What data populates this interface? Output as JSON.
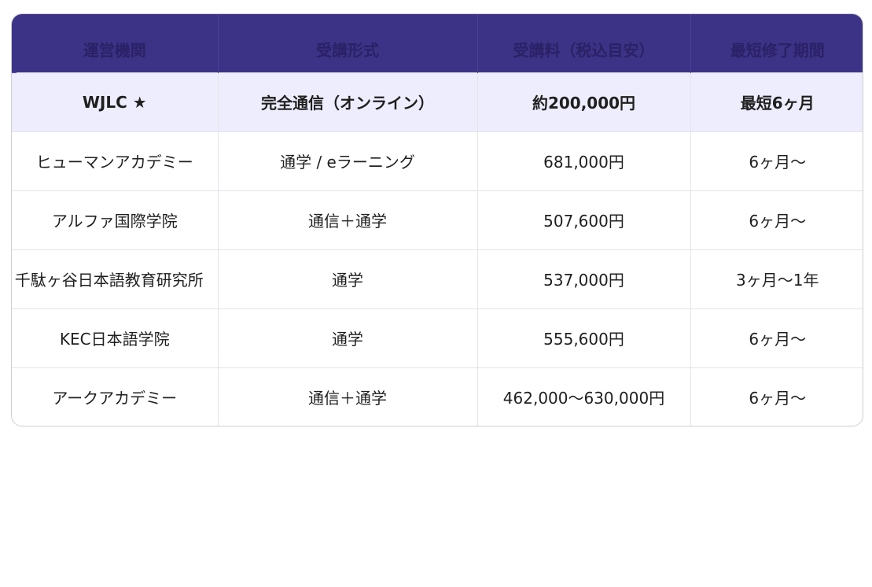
{
  "headers": [
    "運営機関",
    "受講形式",
    "受講料（税込目安）",
    "最短修了期間"
  ],
  "rows": [
    {
      "name": "WJLC ★",
      "format": "完全通信（オンライン）",
      "fee": "約200,000円",
      "period": "最短6ヶ月",
      "highlight": true
    },
    {
      "name": "ヒューマンアカデミー",
      "format": "通学 / eラーニング",
      "fee": "681,000円",
      "period": "6ヶ月〜"
    },
    {
      "name": "アルファ国際学院",
      "format": "通信＋通学",
      "fee": "507,600円",
      "period": "6ヶ月〜"
    },
    {
      "name": "千駄ヶ谷日本語教育研究所",
      "format": "通学",
      "fee": "537,000円",
      "period": "3ヶ月〜1年"
    },
    {
      "name": "KEC日本語学院",
      "format": "通学",
      "fee": "555,600円",
      "period": "6ヶ月〜"
    },
    {
      "name": "アークアカデミー",
      "format": "通信＋通学",
      "fee": "462,000〜630,000円",
      "period": "6ヶ月〜"
    }
  ],
  "colors": {
    "header_bg": "#3c3386",
    "header_text": "#2a2166",
    "highlight_bg": "#eeedfd",
    "accent": "#5a4fc9"
  }
}
